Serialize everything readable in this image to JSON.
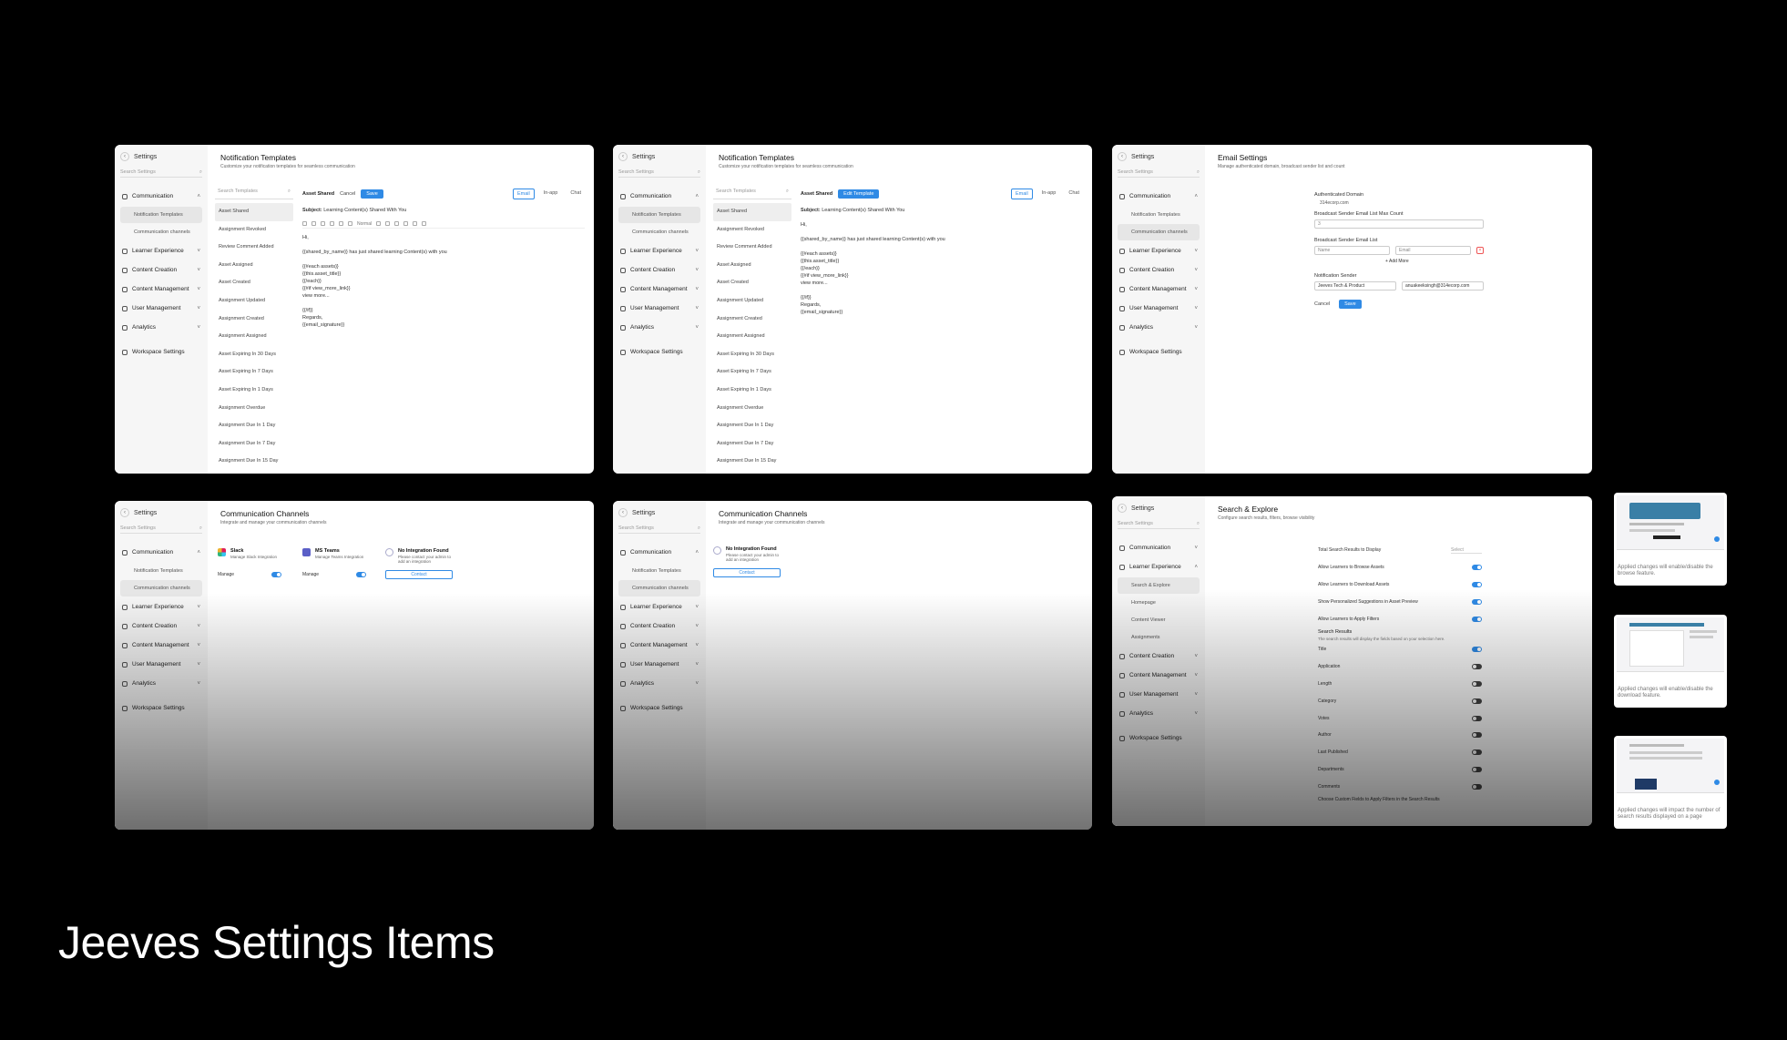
{
  "page_title": "Jeeves Settings Items",
  "sidebar": {
    "title": "Settings",
    "search_placeholder": "Search Settings",
    "groups": [
      "Communication",
      "Learner Experience",
      "Content Creation",
      "Content Management",
      "User Management",
      "Analytics",
      "Workspace Settings"
    ],
    "communication_sub": [
      "Notification Templates",
      "Communication channels"
    ],
    "learner_sub": [
      "Search & Explore",
      "Homepage",
      "Content Viewer",
      "Assignments"
    ]
  },
  "notification_templates": {
    "title": "Notification Templates",
    "subtitle": "Customize your notification templates for seamless communication",
    "search_placeholder": "Search Templates",
    "templates": [
      "Asset Shared",
      "Assignment Revoked",
      "Review Comment Added",
      "Asset Assigned",
      "Asset Created",
      "Assignment Updated",
      "Assignment Created",
      "Assignment Assigned",
      "Asset Expiring In 30 Days",
      "Asset Expiring In 7 Days",
      "Asset Expiring In 1 Days",
      "Assignment Overdue",
      "Assignment Due In 1 Day",
      "Assignment Due In 7 Day",
      "Assignment Due In 15 Day"
    ],
    "selected": "Asset Shared",
    "cancel_label": "Cancel",
    "save_label": "Save",
    "edit_label": "Edit Template",
    "tabs": [
      "Email",
      "In-app",
      "Chat"
    ],
    "subject_label": "Subject:",
    "subject_value": "Learning Content(s) Shared With You",
    "format_label": "Normal",
    "body_lines": [
      "Hi,",
      "{{shared_by_name}} has just shared learning Content(s) with you",
      "{{#each assets}}",
      "{{this.asset_title}}",
      "{{/each}}",
      "{{#if view_more_link}}",
      "view more...",
      "{{/if}}",
      "Regards,",
      "{{email_signature}}"
    ]
  },
  "email_settings": {
    "title": "Email Settings",
    "subtitle": "Manage authenticated domain, broadcast sender list and count",
    "authenticated_domain_label": "Authenticated Domain",
    "authenticated_domain_value": "314ecorp.com",
    "max_count_label": "Broadcast Sender Email List Max Count",
    "max_count_value": "3",
    "sender_list_label": "Broadcast Sender Email List",
    "name_placeholder": "Name",
    "email_placeholder": "Email",
    "add_more_label": "+ Add More",
    "notification_sender_label": "Notification Sender",
    "sender_name": "Jeeves Tech & Product",
    "sender_email": "anuakeeksingh@314ecorp.com",
    "cancel_label": "Cancel",
    "save_label": "Save"
  },
  "communication_channels": {
    "title": "Communication Channels",
    "subtitle": "Integrate and manage your communication channels",
    "slack_name": "Slack",
    "slack_desc": "Manage Slack Integration",
    "teams_name": "MS Teams",
    "teams_desc": "Manage Teams Integration",
    "none_name": "No Integration Found",
    "none_desc": "Please contact your admin to add an integration",
    "manage_label": "Manage",
    "contact_label": "Contact"
  },
  "search_explore": {
    "title": "Search & Explore",
    "subtitle": "Configure search results, filters, browse visibility",
    "total_label": "Total Search Results to Display",
    "total_value": "Select",
    "toggles": [
      {
        "label": "Allow Learners to Browse Assets",
        "on": true
      },
      {
        "label": "Allow Learners to Download Assets",
        "on": true
      },
      {
        "label": "Show Personalized Suggestions in Asset Preview",
        "on": true
      },
      {
        "label": "Allow Learners to Apply Filters",
        "on": true
      }
    ],
    "results_heading": "Search Results",
    "results_desc": "The search results will display the fields based on your selection here.",
    "fields": [
      {
        "label": "Title",
        "on": true
      },
      {
        "label": "Application",
        "on": false
      },
      {
        "label": "Length",
        "on": false
      },
      {
        "label": "Category",
        "on": false
      },
      {
        "label": "Votes",
        "on": false
      },
      {
        "label": "Author",
        "on": false
      },
      {
        "label": "Last Published",
        "on": false
      },
      {
        "label": "Departments",
        "on": false
      },
      {
        "label": "Comments",
        "on": false
      }
    ],
    "custom_fields_label": "Choose Custom Fields to Apply Filters in the Search Results"
  },
  "thumbnails": [
    "Applied changes will enable/disable the browse feature.",
    "Applied changes will enable/disable the download feature.",
    "Applied changes will impact the number of search results displayed on a page"
  ]
}
